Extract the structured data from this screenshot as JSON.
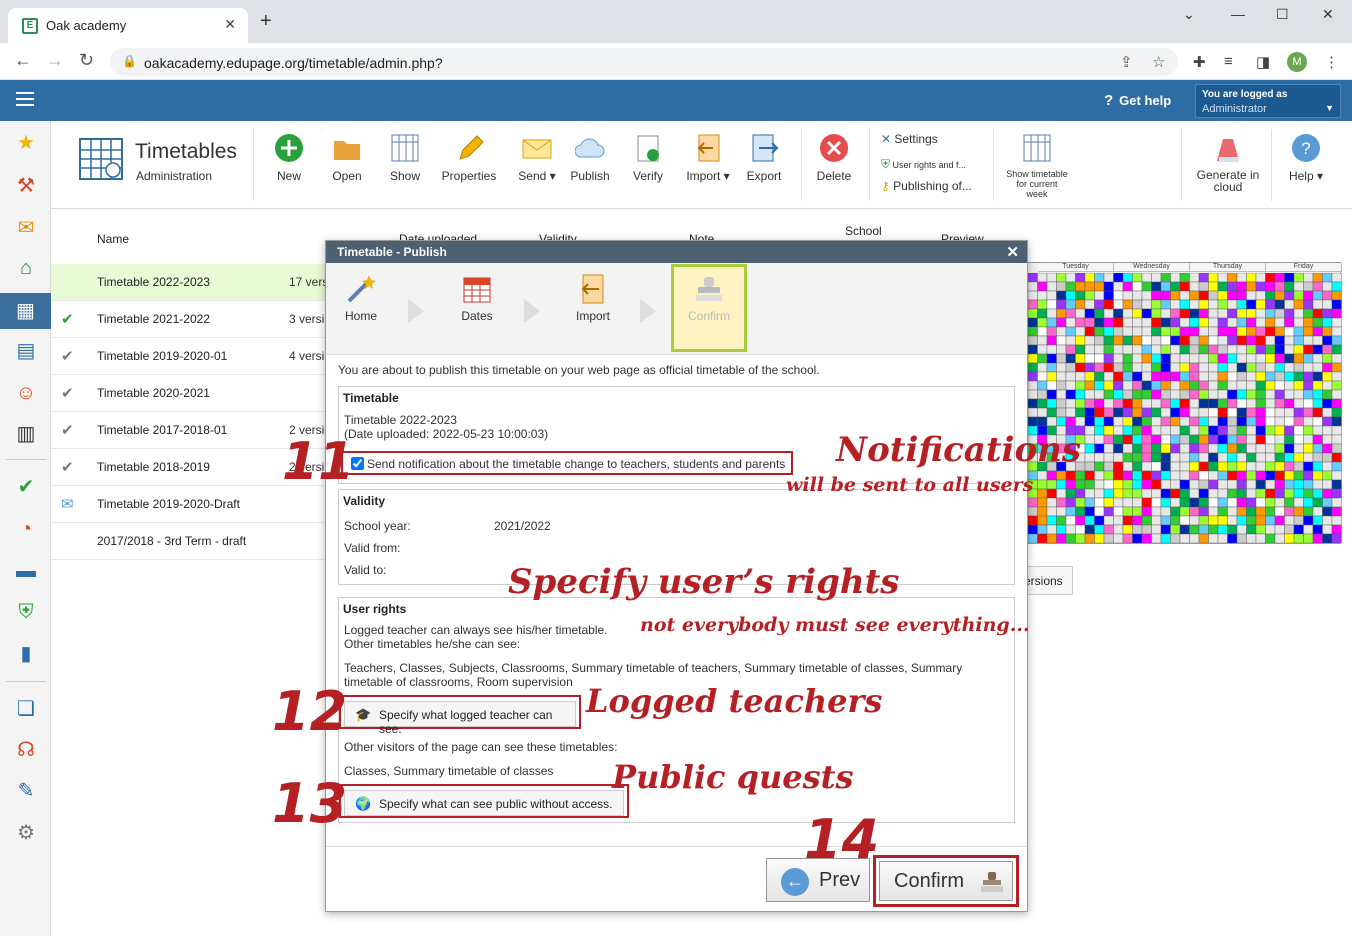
{
  "browser": {
    "tab_title": "Oak academy",
    "favicon_letter": "E",
    "url": "oakacademy.edupage.org/timetable/admin.php?",
    "profile_initial": "M"
  },
  "header": {
    "get_help": "Get help",
    "logged_as_label": "You are logged as",
    "logged_as_user": "Administrator"
  },
  "ribbon": {
    "title": "Timetables",
    "subtitle": "Administration",
    "buttons": [
      {
        "label": "New"
      },
      {
        "label": "Open"
      },
      {
        "label": "Show"
      },
      {
        "label": "Properties"
      },
      {
        "label": "Send"
      },
      {
        "label": "Publish"
      },
      {
        "label": "Verify"
      },
      {
        "label": "Import"
      },
      {
        "label": "Export"
      },
      {
        "label": "Delete"
      }
    ],
    "settings": "Settings",
    "user_rights": "User rights and f...",
    "publishing": "Publishing of...",
    "show_current_week": [
      "Show timetable",
      "for current",
      "week"
    ],
    "generate_cloud": [
      "Generate in",
      "cloud"
    ],
    "help": "Help"
  },
  "list": {
    "col_name": "Name",
    "col_date": "Date uploaded",
    "col_validity": "Validity",
    "col_note": "Note",
    "col_school": "School",
    "col_preview": "Preview",
    "rows": [
      {
        "name": "Timetable 2022-2023",
        "versions": "17 versions",
        "check": ""
      },
      {
        "name": "Timetable 2021-2022",
        "versions": "3 versions",
        "check": "✔"
      },
      {
        "name": "Timetable 2019-2020-01",
        "versions": "4 versions",
        "check": "✔"
      },
      {
        "name": "Timetable 2020-2021",
        "versions": "",
        "check": "✔"
      },
      {
        "name": "Timetable 2017-2018-01",
        "versions": "2 versions",
        "check": "✔"
      },
      {
        "name": "Timetable 2018-2019",
        "versions": "2 versions",
        "check": "✔"
      },
      {
        "name": "Timetable 2019-2020-Draft",
        "versions": "",
        "check": "✉"
      },
      {
        "name": "2017/2018 - 3rd Term - draft",
        "versions": "",
        "check": ""
      }
    ],
    "preview_days": [
      "Tuesday",
      "Wednesday",
      "Thursday",
      "Friday"
    ],
    "versions_button": "ersions"
  },
  "dialog": {
    "title": "Timetable - Publish",
    "steps": [
      {
        "label": "Home"
      },
      {
        "label": "Dates"
      },
      {
        "label": "Import"
      },
      {
        "label": "Confirm"
      }
    ],
    "intro": "You are about to publish this timetable on your web page as official timetable of the school.",
    "timetable_section": "Timetable",
    "timetable_name": "Timetable 2022-2023",
    "timetable_uploaded": "(Date uploaded: 2022-05-23 10:00:03)",
    "notify_label": "Send notification about the timetable change to teachers, students and parents",
    "validity_section": "Validity",
    "school_year_label": "School year:",
    "school_year_value": "2021/2022",
    "valid_from_label": "Valid from:",
    "valid_to_label": "Valid to:",
    "rights_section": "User rights",
    "rights_line1": "Logged teacher can always see his/her timetable.",
    "rights_line2": "Other timetables he/she can see:",
    "rights_teacher_list": "Teachers, Classes, Subjects, Classrooms, Summary timetable of teachers, Summary timetable of classes, Summary",
    "rights_teacher_list2": "timetable of classrooms, Room supervision",
    "btn_teacher": "Specify what logged teacher can see.",
    "rights_visitors": "Other visitors of the page can see these timetables:",
    "rights_public_list": "Classes, Summary timetable of classes",
    "btn_public": "Specify what can see public without access.",
    "prev": "Prev",
    "confirm": "Confirm"
  },
  "annotations": {
    "n11": "11",
    "n12": "12",
    "n13": "13",
    "n14": "14",
    "notifications": "Notifications",
    "notifications_sub": "will be sent to all users",
    "rights": "Specify user’s rights",
    "rights_sub": "not everybody must see everything...",
    "logged": "Logged teachers",
    "public": "Public quests"
  },
  "colors": {
    "header_blue": "#2e6da4",
    "annotation_red": "#b52025",
    "selected_row": "#eaf9d6",
    "confirm_highlight": "#a8cc3a"
  }
}
